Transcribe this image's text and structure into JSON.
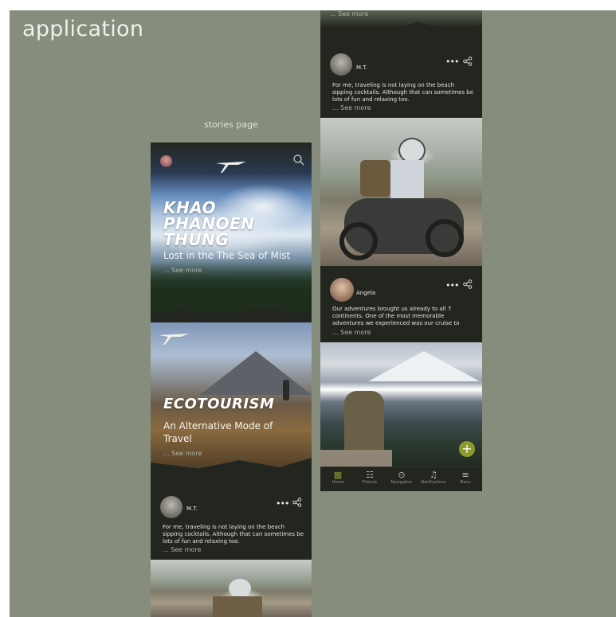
{
  "board": {
    "title": "application",
    "caption": "stories page"
  },
  "left_phone": {
    "hero1": {
      "title_lines": [
        "KHAO",
        "PHANOEN",
        "THUNG"
      ],
      "subtitle": "Lost in the The Sea of Mist",
      "see_more": "... See more"
    },
    "hero2": {
      "title": "ECOTOURISM",
      "subtitle_lines": [
        "An Alternative Mode of",
        "Travel"
      ],
      "see_more": "... See more"
    },
    "post": {
      "author": "M.T.",
      "text_lines": [
        "For me, traveling is not laying on the beach",
        "sipping cocktails. Although that can sometimes be",
        "lots of fun and relaxing too."
      ],
      "see_more": "... See more"
    }
  },
  "right_phone": {
    "top_see_more": "... See more",
    "post1": {
      "author": "M.T.",
      "text_lines": [
        "For me, traveling is not laying on the beach",
        "sipping cocktails. Although that can sometimes be",
        "lots of fun and relaxing too."
      ],
      "see_more": "... See more"
    },
    "post2": {
      "author": "Angela",
      "text_lines": [
        "Our adventures brought us already to all 7",
        "continents. One of the most memorable",
        "adventures we experienced was our cruise to"
      ],
      "see_more": "... See more"
    },
    "fab_label": "+",
    "nav": [
      {
        "icon": "grid-icon",
        "glyph": "▦",
        "label": "Home"
      },
      {
        "icon": "people-icon",
        "glyph": "☷",
        "label": "Friends"
      },
      {
        "icon": "location-icon",
        "glyph": "⊙",
        "label": "Navigation"
      },
      {
        "icon": "bell-icon",
        "glyph": "♫",
        "label": "Notifications"
      },
      {
        "icon": "menu-icon",
        "glyph": "≡",
        "label": "Menu"
      }
    ],
    "accent_color": "#8d9a2e"
  }
}
